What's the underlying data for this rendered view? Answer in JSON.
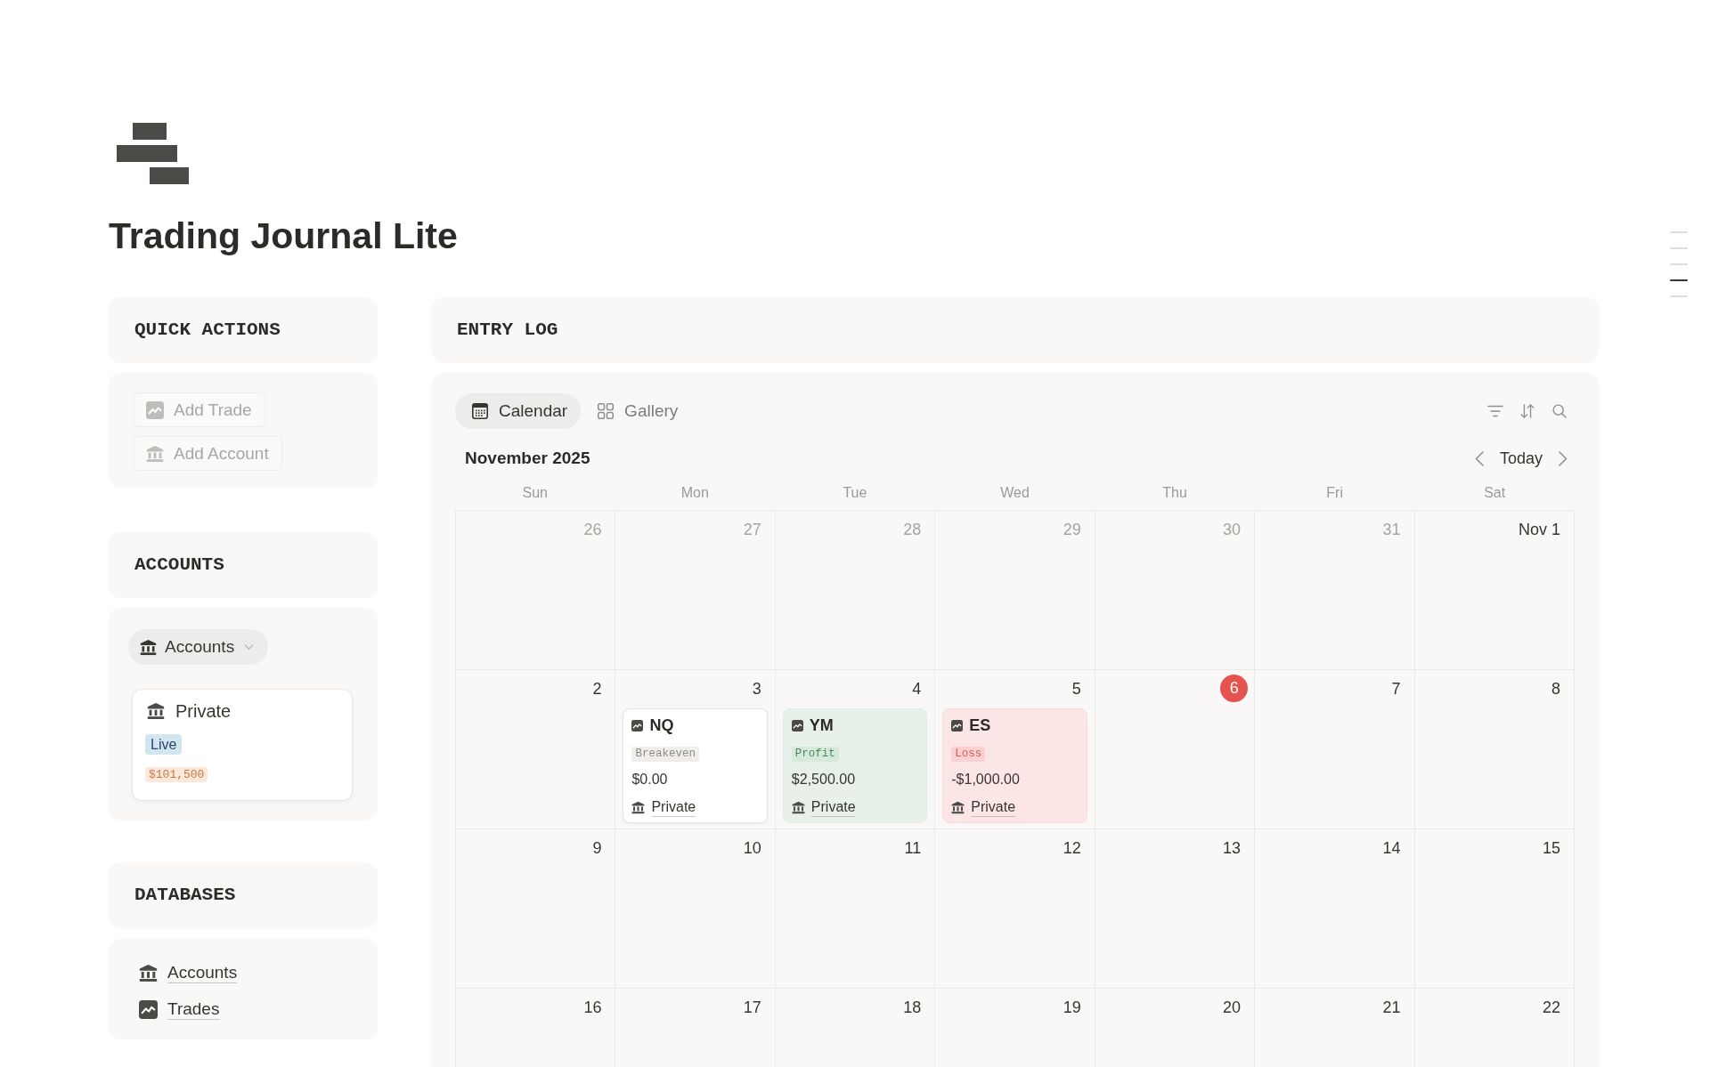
{
  "page": {
    "title": "Trading Journal Lite"
  },
  "outline_markers": [
    {
      "selected": false
    },
    {
      "selected": false
    },
    {
      "selected": false
    },
    {
      "selected": true
    },
    {
      "selected": false
    }
  ],
  "quick_actions": {
    "heading": "QUICK ACTIONS",
    "buttons": [
      {
        "label": "Add Trade",
        "kind": "trade",
        "disabled": true
      },
      {
        "label": "Add Account",
        "kind": "account",
        "disabled": true
      }
    ]
  },
  "accounts": {
    "heading": "ACCOUNTS",
    "view_button": {
      "label": "Accounts"
    },
    "cards": [
      {
        "name": "Private",
        "status": "Live",
        "balance": "$101,500"
      }
    ]
  },
  "databases": {
    "heading": "DATABASES",
    "links": [
      {
        "label": "Accounts",
        "kind": "account"
      },
      {
        "label": "Trades",
        "kind": "trade"
      }
    ]
  },
  "entry_log": {
    "heading": "ENTRY LOG",
    "tabs": [
      {
        "label": "Calendar",
        "selected": true
      },
      {
        "label": "Gallery",
        "selected": false
      }
    ],
    "month": "November 2025",
    "today_button": "Today",
    "weekdays": [
      "Sun",
      "Mon",
      "Tue",
      "Wed",
      "Thu",
      "Fri",
      "Sat"
    ],
    "weeks": [
      [
        {
          "day": "26",
          "in_month": false,
          "today": false
        },
        {
          "day": "27",
          "in_month": false,
          "today": false
        },
        {
          "day": "28",
          "in_month": false,
          "today": false
        },
        {
          "day": "29",
          "in_month": false,
          "today": false
        },
        {
          "day": "30",
          "in_month": false,
          "today": false
        },
        {
          "day": "31",
          "in_month": false,
          "today": false
        },
        {
          "day": "Nov 1",
          "in_month": true,
          "today": false
        }
      ],
      [
        {
          "day": "2",
          "in_month": true,
          "today": false
        },
        {
          "day": "3",
          "in_month": true,
          "today": false,
          "entries": [
            {
              "kind": "breakeven",
              "symbol": "NQ",
              "result": "Breakeven",
              "amount": "$0.00",
              "account": "Private"
            }
          ]
        },
        {
          "day": "4",
          "in_month": true,
          "today": false,
          "entries": [
            {
              "kind": "profit",
              "symbol": "YM",
              "result": "Profit",
              "amount": "$2,500.00",
              "account": "Private"
            }
          ]
        },
        {
          "day": "5",
          "in_month": true,
          "today": false,
          "entries": [
            {
              "kind": "loss",
              "symbol": "ES",
              "result": "Loss",
              "amount": "-$1,000.00",
              "account": "Private"
            }
          ]
        },
        {
          "day": "6",
          "in_month": true,
          "today": true
        },
        {
          "day": "7",
          "in_month": true,
          "today": false
        },
        {
          "day": "8",
          "in_month": true,
          "today": false
        }
      ],
      [
        {
          "day": "9",
          "in_month": true,
          "today": false
        },
        {
          "day": "10",
          "in_month": true,
          "today": false
        },
        {
          "day": "11",
          "in_month": true,
          "today": false
        },
        {
          "day": "12",
          "in_month": true,
          "today": false
        },
        {
          "day": "13",
          "in_month": true,
          "today": false
        },
        {
          "day": "14",
          "in_month": true,
          "today": false
        },
        {
          "day": "15",
          "in_month": true,
          "today": false
        }
      ],
      [
        {
          "day": "16",
          "in_month": true,
          "today": false
        },
        {
          "day": "17",
          "in_month": true,
          "today": false
        },
        {
          "day": "18",
          "in_month": true,
          "today": false
        },
        {
          "day": "19",
          "in_month": true,
          "today": false
        },
        {
          "day": "20",
          "in_month": true,
          "today": false
        },
        {
          "day": "21",
          "in_month": true,
          "today": false
        },
        {
          "day": "22",
          "in_month": true,
          "today": false
        }
      ]
    ]
  }
}
